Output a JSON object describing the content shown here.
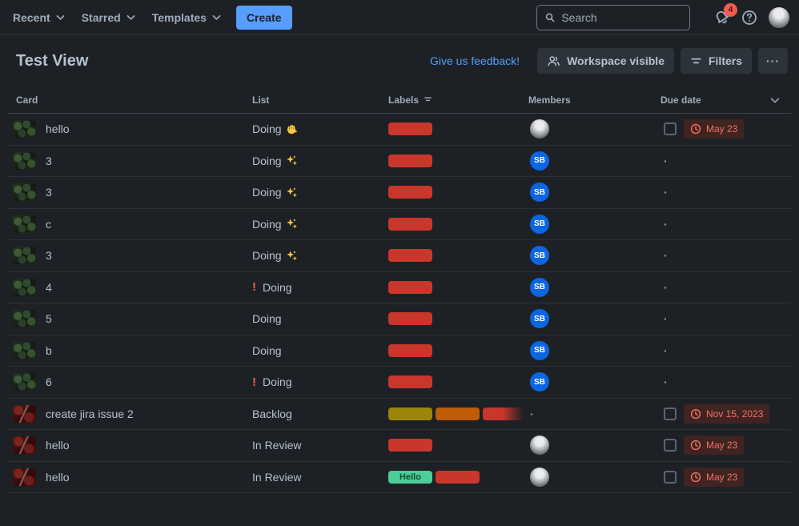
{
  "colors": {
    "accent_blue": "#579DFF",
    "labels": {
      "red": "#C9372C",
      "yellow": "#9B860A",
      "orange": "#BF5C08",
      "green": "#4BCE97"
    },
    "due_badge_bg": "#3F2421",
    "due_badge_text": "#F87168",
    "notification_badge": "#F15B50"
  },
  "nav": {
    "items": [
      {
        "label": "Recent"
      },
      {
        "label": "Starred"
      },
      {
        "label": "Templates"
      }
    ],
    "create_label": "Create",
    "search_placeholder": "Search",
    "notification_count": "4"
  },
  "view_header": {
    "title": "Test View",
    "feedback_link": "Give us feedback!",
    "workspace_button": "Workspace visible",
    "filters_button": "Filters",
    "more_label": "···"
  },
  "table": {
    "columns": [
      "Card",
      "List",
      "Labels",
      "Members",
      "Due date"
    ],
    "empty_cell_marker": "·",
    "rows": [
      {
        "card": "hello",
        "thumb": "green",
        "list": "Doing",
        "emoji": {
          "name": "wave",
          "char": "👋",
          "position": "after"
        },
        "labels": [
          {
            "color": "red"
          }
        ],
        "member": {
          "type": "photo"
        },
        "due": {
          "type": "badge",
          "text": "May 23",
          "checkbox_checked": false
        }
      },
      {
        "card": "3",
        "thumb": "green",
        "list": "Doing",
        "emoji": {
          "name": "sparkles",
          "char": "✨",
          "position": "after"
        },
        "labels": [
          {
            "color": "red"
          }
        ],
        "member": {
          "type": "initials",
          "text": "SB"
        },
        "due": {
          "type": "dot"
        }
      },
      {
        "card": "3",
        "thumb": "green",
        "list": "Doing",
        "emoji": {
          "name": "sparkles",
          "char": "✨",
          "position": "after"
        },
        "labels": [
          {
            "color": "red"
          }
        ],
        "member": {
          "type": "initials",
          "text": "SB"
        },
        "due": {
          "type": "dot"
        }
      },
      {
        "card": "c",
        "thumb": "green",
        "list": "Doing",
        "emoji": {
          "name": "sparkles",
          "char": "✨",
          "position": "after"
        },
        "labels": [
          {
            "color": "red"
          }
        ],
        "member": {
          "type": "initials",
          "text": "SB"
        },
        "due": {
          "type": "dot"
        }
      },
      {
        "card": "3",
        "thumb": "green",
        "list": "Doing",
        "emoji": {
          "name": "sparkles",
          "char": "✨",
          "position": "after"
        },
        "labels": [
          {
            "color": "red"
          }
        ],
        "member": {
          "type": "initials",
          "text": "SB"
        },
        "due": {
          "type": "dot"
        }
      },
      {
        "card": "4",
        "thumb": "green",
        "list": "Doing",
        "emoji": {
          "name": "exclamation",
          "char": "❗",
          "position": "before"
        },
        "labels": [
          {
            "color": "red"
          }
        ],
        "member": {
          "type": "initials",
          "text": "SB"
        },
        "due": {
          "type": "dot"
        }
      },
      {
        "card": "5",
        "thumb": "green",
        "list": "Doing",
        "emoji": null,
        "labels": [
          {
            "color": "red"
          }
        ],
        "member": {
          "type": "initials",
          "text": "SB"
        },
        "due": {
          "type": "dot"
        }
      },
      {
        "card": "b",
        "thumb": "green",
        "list": "Doing",
        "emoji": null,
        "labels": [
          {
            "color": "red"
          }
        ],
        "member": {
          "type": "initials",
          "text": "SB"
        },
        "due": {
          "type": "dot"
        }
      },
      {
        "card": "6",
        "thumb": "green",
        "list": "Doing",
        "emoji": {
          "name": "exclamation",
          "char": "❗",
          "position": "before"
        },
        "labels": [
          {
            "color": "red"
          }
        ],
        "member": {
          "type": "initials",
          "text": "SB"
        },
        "due": {
          "type": "dot"
        }
      },
      {
        "card": "create jira issue 2",
        "thumb": "red",
        "list": "Backlog",
        "emoji": null,
        "labels": [
          {
            "color": "yellow"
          },
          {
            "color": "orange"
          },
          {
            "color": "red",
            "faded": true
          }
        ],
        "member": {
          "type": "dot"
        },
        "due": {
          "type": "badge",
          "text": "Nov 15, 2023",
          "checkbox_checked": false
        }
      },
      {
        "card": "hello",
        "thumb": "red",
        "list": "In Review",
        "emoji": null,
        "labels": [
          {
            "color": "red"
          }
        ],
        "member": {
          "type": "photo"
        },
        "due": {
          "type": "badge",
          "text": "May 23",
          "checkbox_checked": false
        }
      },
      {
        "card": "hello",
        "thumb": "red",
        "list": "In Review",
        "emoji": null,
        "labels": [
          {
            "color": "green",
            "text": "Hello"
          },
          {
            "color": "red"
          }
        ],
        "member": {
          "type": "photo"
        },
        "due": {
          "type": "badge",
          "text": "May 23",
          "checkbox_checked": false
        }
      }
    ]
  }
}
